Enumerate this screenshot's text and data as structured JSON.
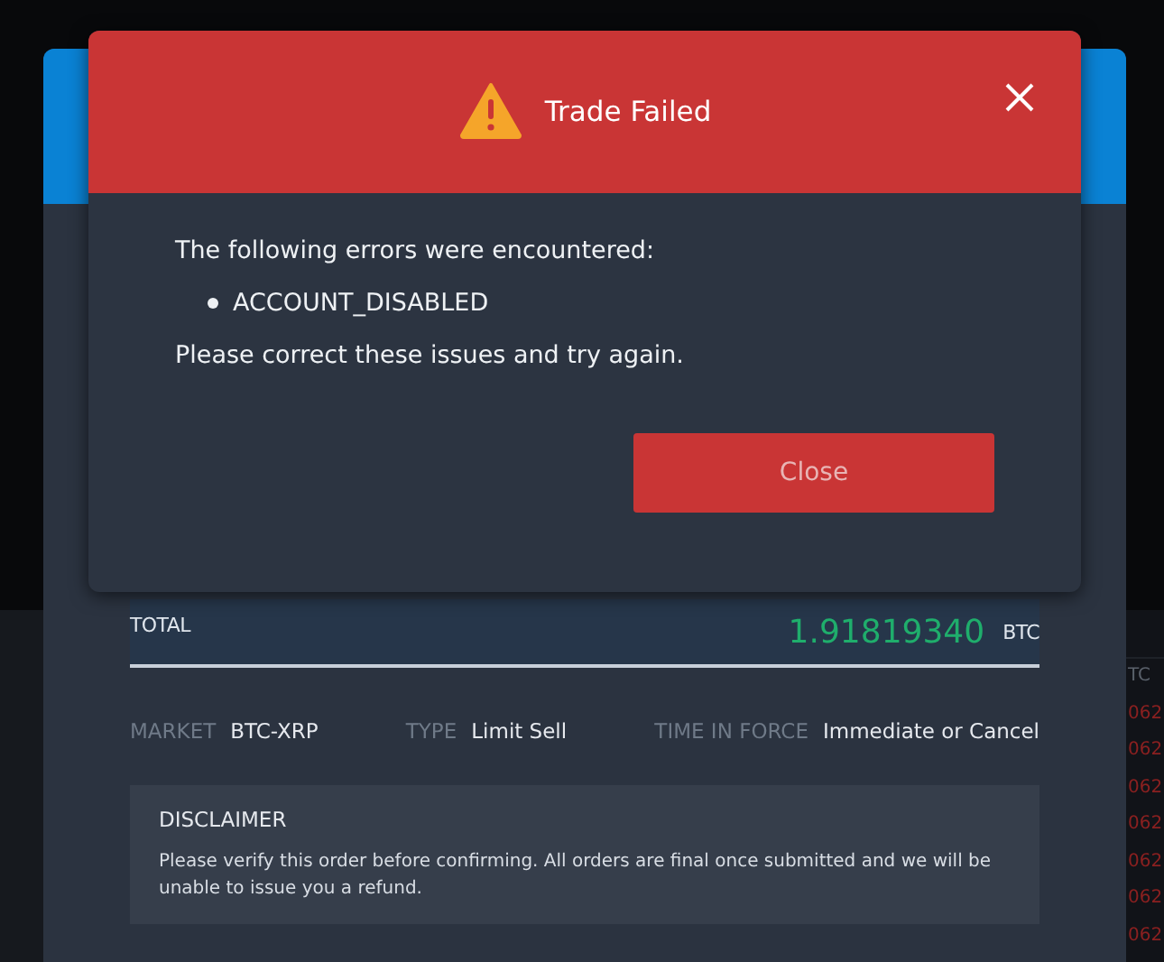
{
  "order": {
    "total_label": "TOTAL",
    "total_value": "1.91819340",
    "total_unit": "BTC",
    "details": [
      {
        "label": "MARKET",
        "value": "BTC-XRP"
      },
      {
        "label": "TYPE",
        "value": "Limit Sell"
      },
      {
        "label": "TIME IN FORCE",
        "value": "Immediate or Cancel"
      }
    ],
    "disclaimer": {
      "title": "DISCLAIMER",
      "text": "Please verify this order before confirming. All orders are final once submitted and we will be unable to issue you a refund."
    }
  },
  "order_book": {
    "column_1": "TC",
    "rows": [
      "062",
      "062",
      "062",
      "062",
      "062",
      "062",
      "062"
    ]
  },
  "dialog": {
    "title": "Trade Failed",
    "intro": "The following errors were encountered:",
    "errors": [
      "ACCOUNT_DISABLED"
    ],
    "outro": "Please correct these issues and try again.",
    "buttons": [
      "Close"
    ]
  }
}
